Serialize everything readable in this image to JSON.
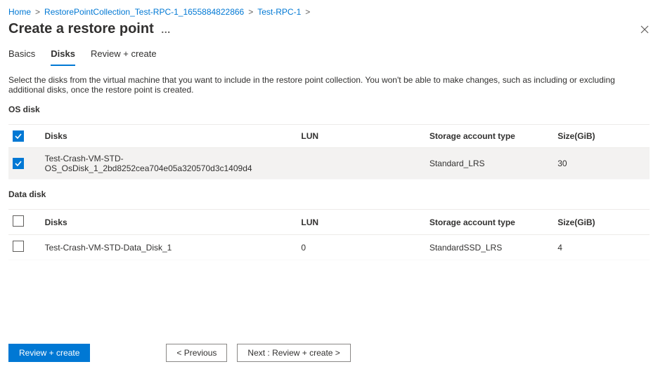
{
  "breadcrumb": {
    "home": "Home",
    "collection": "RestorePointCollection_Test-RPC-1_1655884822866",
    "item": "Test-RPC-1",
    "sep": ">"
  },
  "title": "Create a restore point",
  "ellipsis": "…",
  "tabs": {
    "basics": "Basics",
    "disks": "Disks",
    "review": "Review + create"
  },
  "description": "Select the disks from the virtual machine that you want to include in the restore point collection. You won't be able to make changes, such as including or excluding additional disks, once the restore point is created.",
  "sections": {
    "os": "OS disk",
    "data": "Data disk"
  },
  "columns": {
    "disks": "Disks",
    "lun": "LUN",
    "sat": "Storage account type",
    "size": "Size(GiB)"
  },
  "os_rows": [
    {
      "name": "Test-Crash-VM-STD-OS_OsDisk_1_2bd8252cea704e05a320570d3c1409d4",
      "lun": "",
      "sat": "Standard_LRS",
      "size": "30"
    }
  ],
  "data_rows": [
    {
      "name": "Test-Crash-VM-STD-Data_Disk_1",
      "lun": "0",
      "sat": "StandardSSD_LRS",
      "size": "4"
    }
  ],
  "footer": {
    "review": "Review + create",
    "prev": "< Previous",
    "next": "Next : Review + create >"
  }
}
